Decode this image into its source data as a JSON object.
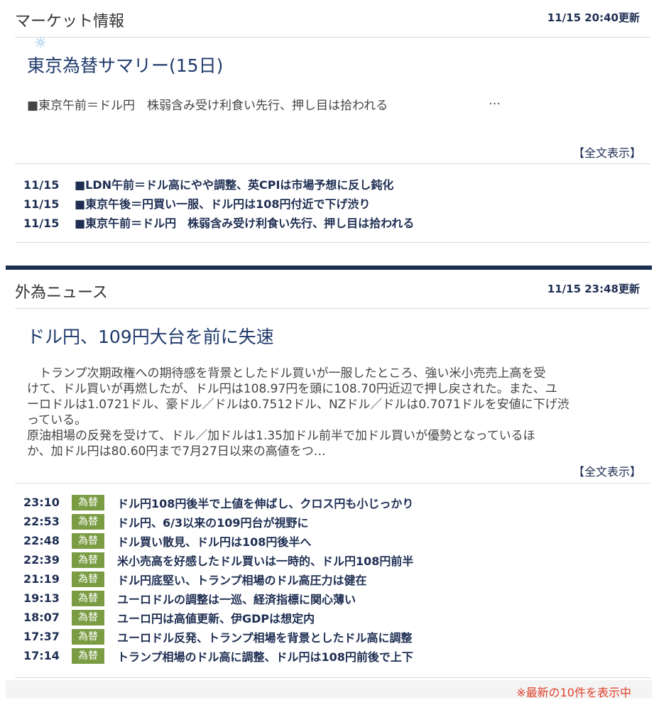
{
  "market": {
    "title": "マーケット情報",
    "updated": "11/15 20:40更新",
    "headline": "東京為替サマリー(15日)",
    "summary": "■東京午前＝ドル円　株弱含み受け利食い先行、押し目は拾われる",
    "ellipsis": "…",
    "full_text": "【全文表示】",
    "news": [
      {
        "date": "11/15",
        "title": "■LDN午前＝ドル高にやや調整、英CPIは市場予想に反し鈍化"
      },
      {
        "date": "11/15",
        "title": "■東京午後＝円買い一服、ドル円は108円付近で下げ渋り"
      },
      {
        "date": "11/15",
        "title": "■東京午前＝ドル円　株弱含み受け利食い先行、押し目は拾われる"
      }
    ]
  },
  "fx": {
    "title": "外為ニュース",
    "updated": "11/15 23:48更新",
    "headline": "ドル円、109円大台を前に失速",
    "body_lines": [
      "　トランプ次期政権への期待感を背景としたドル買いが一服したところ、強い米小売売上高を受",
      "けて、ドル買いが再燃したが、ドル円は108.97円を頭に108.70円近辺で押し戻された。また、ユ",
      "ーロドルは1.0721ドル、豪ドル／ドルは0.7512ドル、NZドル／ドルは0.7071ドルを安値に下げ渋",
      "っている。",
      "原油相場の反発を受けて、ドル／加ドルは1.35加ドル前半で加ドル買いが優勢となっているほ",
      "か、加ドル円は80.60円まで7月27日以来の高値をつ…"
    ],
    "full_text": "【全文表示】",
    "badge": "為替",
    "news": [
      {
        "time": "23:10",
        "title": "ドル円108円後半で上値を伸ばし、クロス円も小じっかり"
      },
      {
        "time": "22:53",
        "title": "ドル円、6/3以来の109円台が視野に"
      },
      {
        "time": "22:48",
        "title": "ドル買い散見、ドル円は108円後半へ"
      },
      {
        "time": "22:39",
        "title": "米小売高を好感したドル買いは一時的、ドル円108円前半"
      },
      {
        "time": "21:19",
        "title": "ドル円底堅い、トランプ相場のドル高圧力は健在"
      },
      {
        "time": "19:13",
        "title": "ユーロドルの調整は一巡、経済指標に関心薄い"
      },
      {
        "time": "18:07",
        "title": "ユーロ円は高値更新、伊GDPは想定内"
      },
      {
        "time": "17:37",
        "title": "ユーロドル反発、トランプ相場を背景としたドル高に調整"
      },
      {
        "time": "17:14",
        "title": "トランプ相場のドル高に調整、ドル円は108円前後で上下"
      }
    ],
    "footer_note": "※最新の10件を表示中"
  }
}
